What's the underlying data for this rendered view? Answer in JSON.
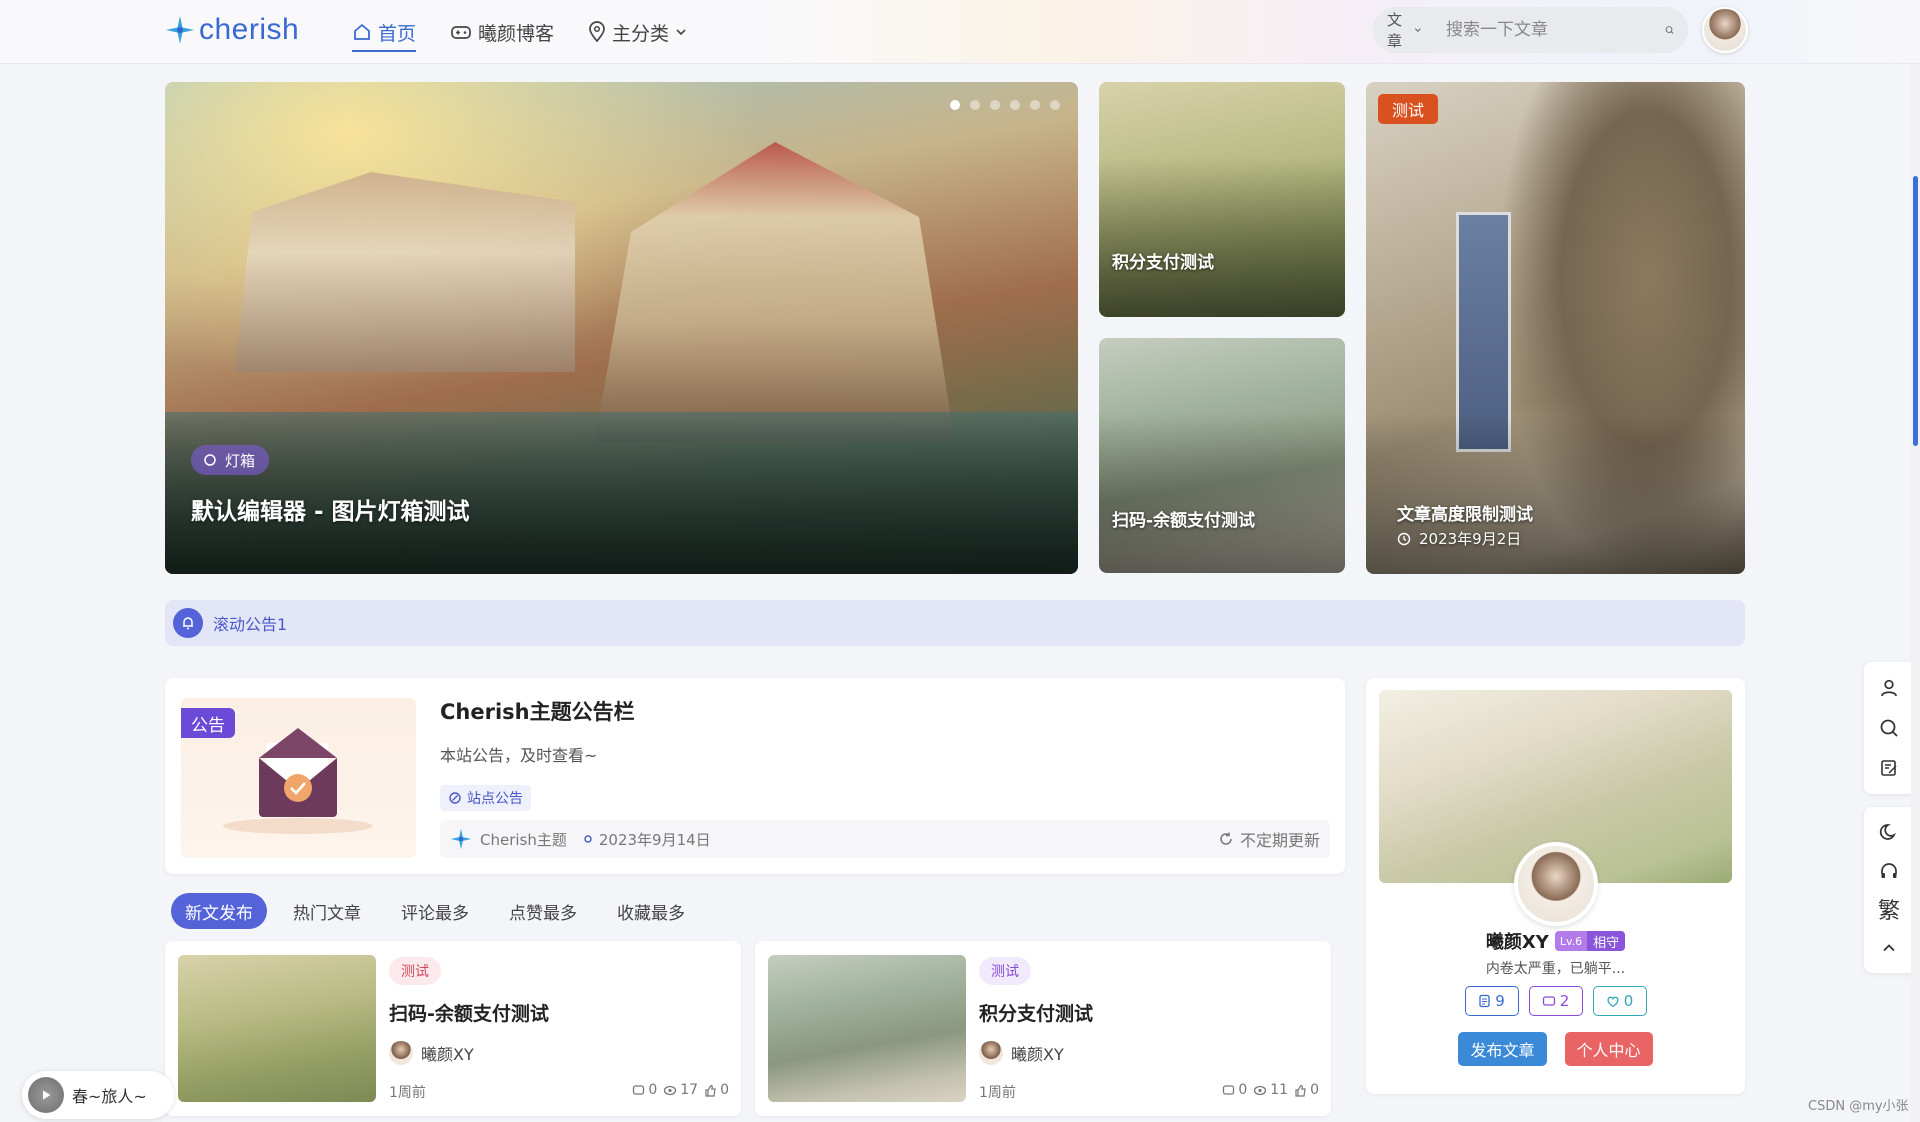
{
  "brand": {
    "name": "cherish",
    "color": "#3a6ad1"
  },
  "nav": [
    {
      "label": "首页",
      "icon": "home-icon",
      "active": true
    },
    {
      "label": "曦颜博客",
      "icon": "gamepad-icon",
      "active": false
    },
    {
      "label": "主分类",
      "icon": "location-pin-icon",
      "active": false
    }
  ],
  "search": {
    "type": "文章",
    "placeholder": "搜索一下文章"
  },
  "slider": {
    "main": {
      "tag": "灯箱",
      "title": "默认编辑器 - 图片灯箱测试",
      "dots": 6,
      "active_dot": 1
    },
    "side1": {
      "title": "积分支付测试"
    },
    "side2": {
      "title": "扫码-余额支付测试"
    },
    "side3": {
      "tag": "测试",
      "title": "文章高度限制测试",
      "date": "2023年9月2日"
    }
  },
  "notice": {
    "text": "滚动公告1"
  },
  "announcement": {
    "badge": "公告",
    "title": "Cherish主题公告栏",
    "desc": "本站公告，及时查看~",
    "category": "站点公告",
    "author": "Cherish主题",
    "date": "2023年9月14日",
    "update": "不定期更新"
  },
  "tabs": [
    {
      "label": "新文发布",
      "active": true
    },
    {
      "label": "热门文章",
      "active": false
    },
    {
      "label": "评论最多",
      "active": false
    },
    {
      "label": "点赞最多",
      "active": false
    },
    {
      "label": "收藏最多",
      "active": false
    }
  ],
  "posts": [
    {
      "tag": "测试",
      "title": "扫码-余额支付测试",
      "author": "曦颜XY",
      "time": "1周前",
      "comments": "0",
      "views": "17",
      "likes": "0"
    },
    {
      "tag": "测试",
      "title": "积分支付测试",
      "author": "曦颜XY",
      "time": "1周前",
      "comments": "0",
      "views": "11",
      "likes": "0"
    }
  ],
  "profile": {
    "name": "曦颜XY",
    "level": "Lv.6",
    "rank": "相守",
    "bio": "内卷太严重，已躺平...",
    "posts": "9",
    "comments": "2",
    "likes": "0",
    "publish_label": "发布文章",
    "center_label": "个人中心"
  },
  "toolbar": {
    "traditional": "繁"
  },
  "player": {
    "song": "春~旅人~"
  },
  "watermark": "CSDN @my小张"
}
